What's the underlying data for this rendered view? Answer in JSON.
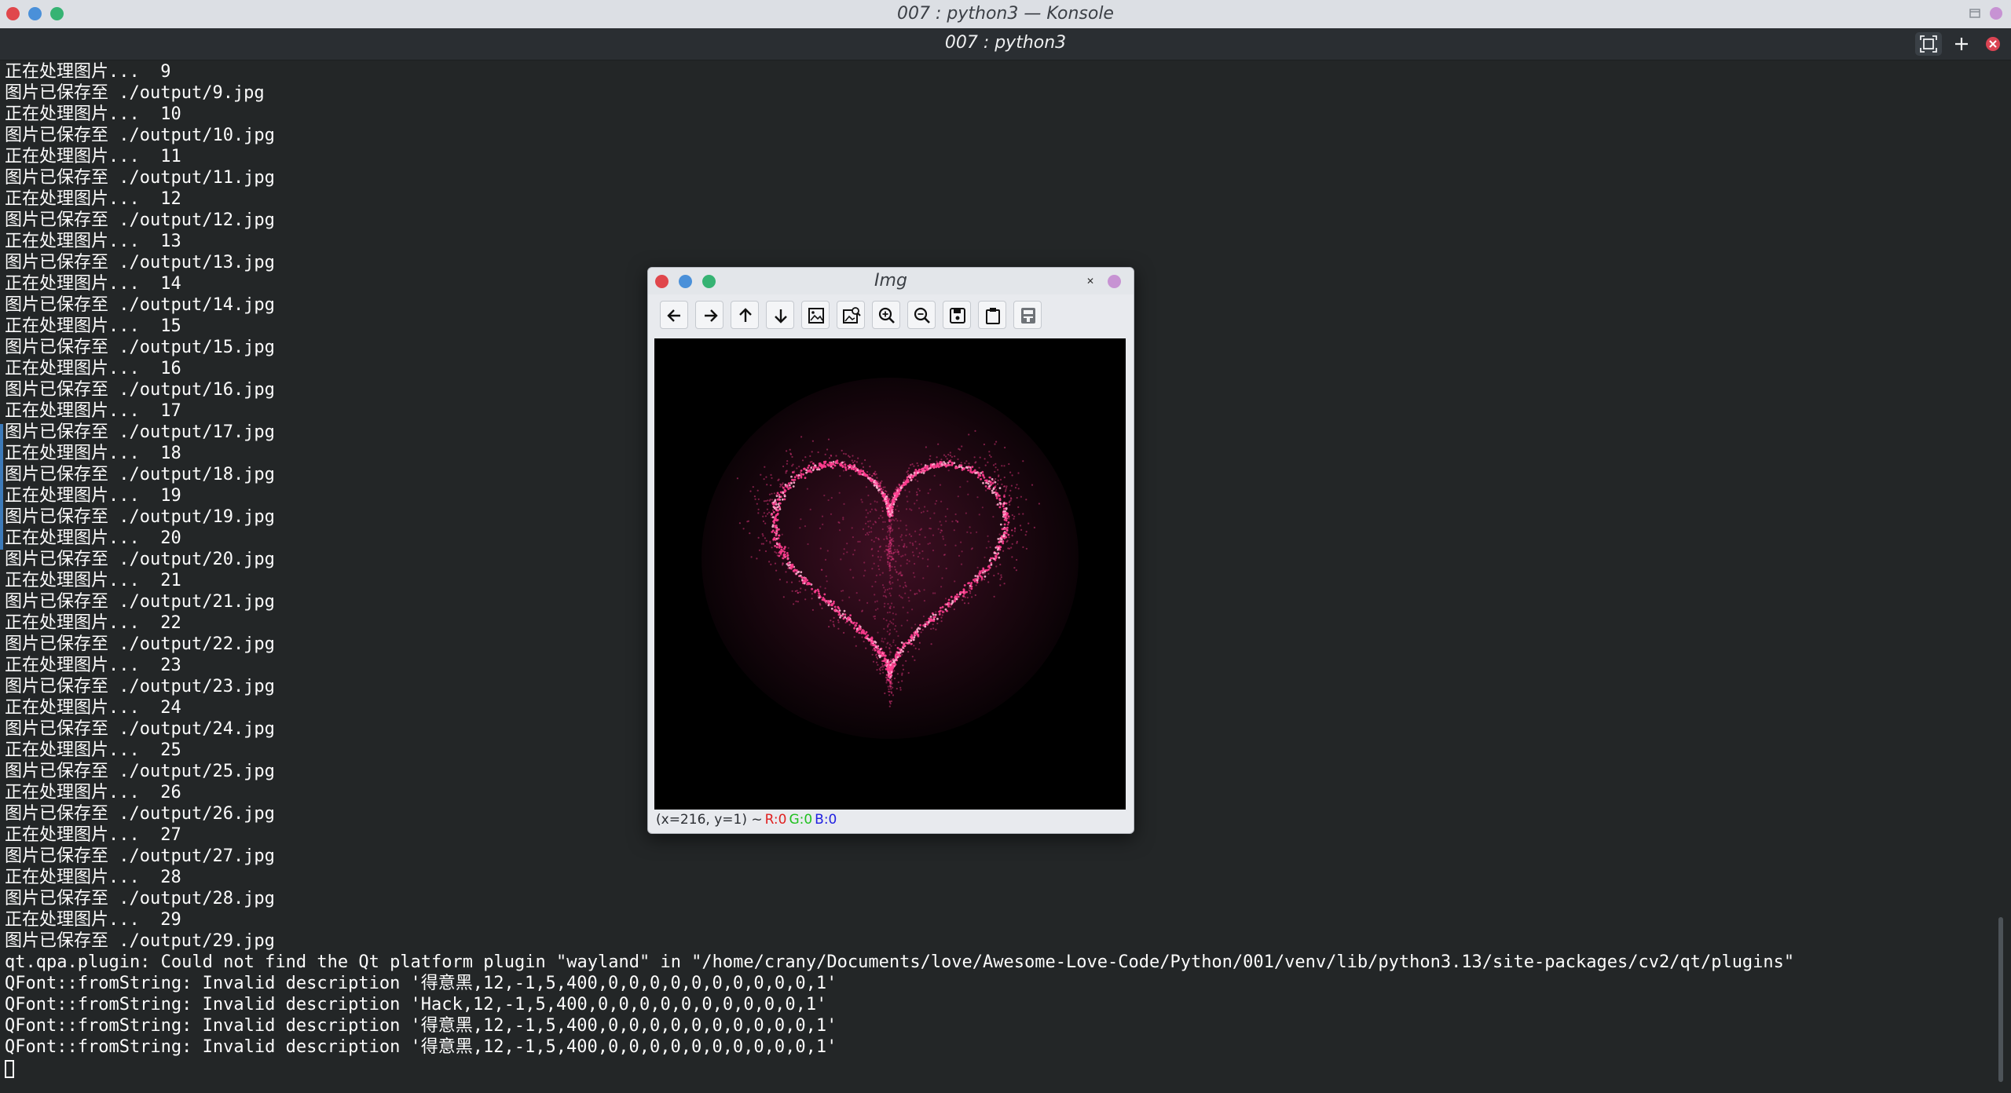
{
  "window": {
    "title": "007 : python3 — Konsole",
    "tab_title": "007 : python3",
    "colors": {
      "close": "#e0474c",
      "minimize": "#4a90d9",
      "maximize": "#36b373"
    }
  },
  "terminal": {
    "lines": [
      "正在处理图片...  9",
      "图片已保存至 ./output/9.jpg",
      "正在处理图片...  10",
      "图片已保存至 ./output/10.jpg",
      "正在处理图片...  11",
      "图片已保存至 ./output/11.jpg",
      "正在处理图片...  12",
      "图片已保存至 ./output/12.jpg",
      "正在处理图片...  13",
      "图片已保存至 ./output/13.jpg",
      "正在处理图片...  14",
      "图片已保存至 ./output/14.jpg",
      "正在处理图片...  15",
      "图片已保存至 ./output/15.jpg",
      "正在处理图片...  16",
      "图片已保存至 ./output/16.jpg",
      "正在处理图片...  17",
      "图片已保存至 ./output/17.jpg",
      "正在处理图片...  18",
      "图片已保存至 ./output/18.jpg",
      "正在处理图片...  19",
      "图片已保存至 ./output/19.jpg",
      "正在处理图片...  20",
      "图片已保存至 ./output/20.jpg",
      "正在处理图片...  21",
      "图片已保存至 ./output/21.jpg",
      "正在处理图片...  22",
      "图片已保存至 ./output/22.jpg",
      "正在处理图片...  23",
      "图片已保存至 ./output/23.jpg",
      "正在处理图片...  24",
      "图片已保存至 ./output/24.jpg",
      "正在处理图片...  25",
      "图片已保存至 ./output/25.jpg",
      "正在处理图片...  26",
      "图片已保存至 ./output/26.jpg",
      "正在处理图片...  27",
      "图片已保存至 ./output/27.jpg",
      "正在处理图片...  28",
      "图片已保存至 ./output/28.jpg",
      "正在处理图片...  29",
      "图片已保存至 ./output/29.jpg",
      "qt.qpa.plugin: Could not find the Qt platform plugin \"wayland\" in \"/home/crany/Documents/love/Awesome-Love-Code/Python/001/venv/lib/python3.13/site-packages/cv2/qt/plugins\"",
      "QFont::fromString: Invalid description '得意黑,12,-1,5,400,0,0,0,0,0,0,0,0,0,0,1'",
      "QFont::fromString: Invalid description 'Hack,12,-1,5,400,0,0,0,0,0,0,0,0,0,0,1'",
      "QFont::fromString: Invalid description '得意黑,12,-1,5,400,0,0,0,0,0,0,0,0,0,0,1'",
      "QFont::fromString: Invalid description '得意黑,12,-1,5,400,0,0,0,0,0,0,0,0,0,0,1'"
    ]
  },
  "image_window": {
    "title": "Img",
    "toolbar": [
      "arrow-left-icon",
      "arrow-right-icon",
      "arrow-up-icon",
      "arrow-down-icon",
      "image-icon",
      "image-zoom-icon",
      "zoom-in-icon",
      "zoom-out-icon",
      "save-icon",
      "clipboard-icon",
      "properties-icon"
    ],
    "status": {
      "coords": "(x=216, y=1) ~",
      "r": "R:0",
      "g": "G:0",
      "b": "B:0",
      "colors": {
        "r": "#e02020",
        "g": "#20c020",
        "b": "#2020e0"
      }
    },
    "image": {
      "subject": "heart-particles",
      "color": "#ff3d8f",
      "background": "#000000"
    }
  }
}
